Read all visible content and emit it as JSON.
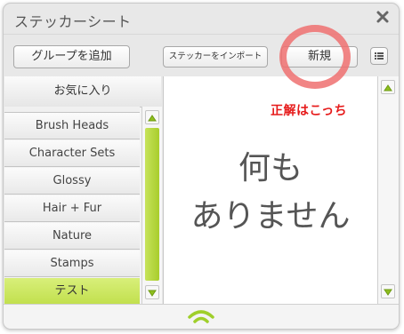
{
  "window": {
    "title": "ステッカーシート"
  },
  "toolbar": {
    "add_group_label": "グループを追加",
    "import_label": "ステッカーをインポート",
    "new_label": "新規"
  },
  "annotation": {
    "text": "正解はこっち",
    "color": "#e61a1a",
    "circle_color": "#ef7070"
  },
  "sidebar": {
    "favorites_label": "お気に入り",
    "items": [
      {
        "label": "Brush Heads"
      },
      {
        "label": "Character Sets"
      },
      {
        "label": "Glossy"
      },
      {
        "label": "Hair + Fur"
      },
      {
        "label": "Nature"
      },
      {
        "label": "Stamps"
      },
      {
        "label": "テスト"
      }
    ],
    "selected_index": 6
  },
  "content": {
    "empty_line1": "何も",
    "empty_line2": "ありません"
  },
  "colors": {
    "accent_green": "#b9dd44",
    "window_bg": "#e8e8e8"
  },
  "icons": {
    "close": "close-icon",
    "menu": "list-menu-icon",
    "scroll_up": "triangle-up-icon",
    "scroll_down": "triangle-down-icon",
    "wifi": "wifi-signal-icon"
  }
}
